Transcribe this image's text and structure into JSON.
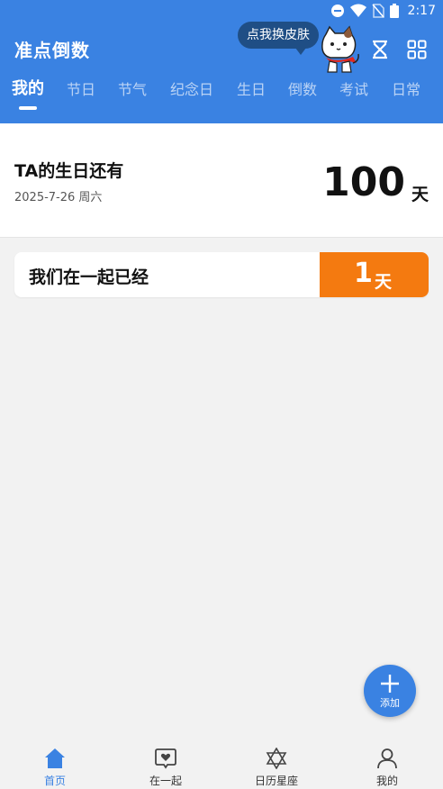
{
  "status_bar": {
    "time": "2:17",
    "icons": [
      "dnd-icon",
      "wifi-icon",
      "no-sim-icon",
      "battery-icon"
    ]
  },
  "header": {
    "title": "准点倒数",
    "skin_bubble": "点我换皮肤",
    "icons": [
      "cat-mascot-icon",
      "hourglass-icon",
      "grid-icon"
    ],
    "tabs": [
      {
        "label": "我的",
        "active": true
      },
      {
        "label": "节日",
        "active": false
      },
      {
        "label": "节气",
        "active": false
      },
      {
        "label": "纪念日",
        "active": false
      },
      {
        "label": "生日",
        "active": false
      },
      {
        "label": "倒数",
        "active": false
      },
      {
        "label": "考试",
        "active": false
      },
      {
        "label": "日常",
        "active": false
      }
    ]
  },
  "birthday_card": {
    "title": "TA的生日还有",
    "date": "2025-7-26 周六",
    "days": "100",
    "unit": "天"
  },
  "together_card": {
    "label": "我们在一起已经",
    "days": "1",
    "unit": "天"
  },
  "fab": {
    "label": "添加",
    "icon": "plus-icon"
  },
  "bottom_nav": [
    {
      "label": "首页",
      "icon": "home-icon",
      "active": true
    },
    {
      "label": "在一起",
      "icon": "heart-chat-icon",
      "active": false
    },
    {
      "label": "日历星座",
      "icon": "star-of-david-icon",
      "active": false
    },
    {
      "label": "我的",
      "icon": "person-icon",
      "active": false
    }
  ],
  "colors": {
    "primary": "#3a82e2",
    "accent_orange": "#f47a10",
    "bubble": "#1f4e85",
    "background": "#f2f2f2"
  }
}
